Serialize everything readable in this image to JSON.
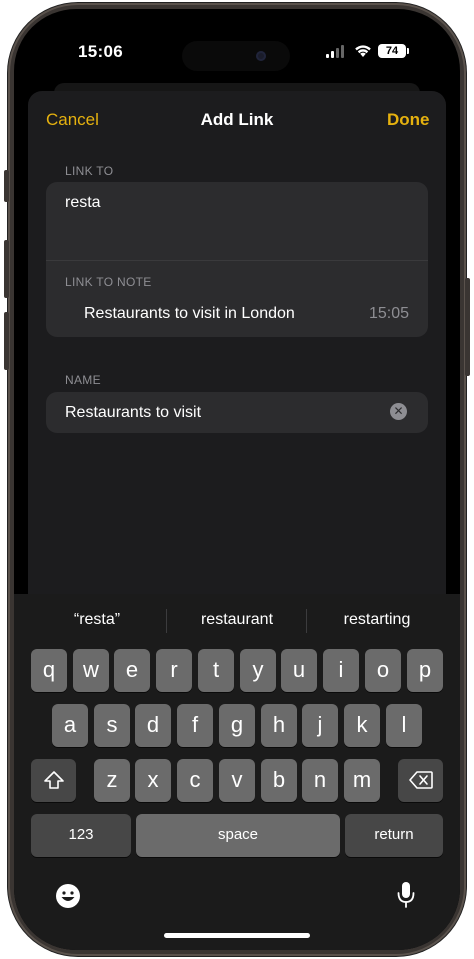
{
  "status_bar": {
    "time": "15:06",
    "battery": "74"
  },
  "nav": {
    "cancel": "Cancel",
    "title": "Add Link",
    "done": "Done"
  },
  "link_to": {
    "label": "LINK TO",
    "value": "resta"
  },
  "link_to_note": {
    "label": "LINK TO NOTE",
    "note_title": "Restaurants to visit in London",
    "note_time": "15:05"
  },
  "name_field": {
    "label": "NAME",
    "value": "Restaurants to visit"
  },
  "suggestions": [
    "“resta”",
    "restaurant",
    "restarting"
  ],
  "keyboard": {
    "row1": [
      "q",
      "w",
      "e",
      "r",
      "t",
      "y",
      "u",
      "i",
      "o",
      "p"
    ],
    "row2": [
      "a",
      "s",
      "d",
      "f",
      "g",
      "h",
      "j",
      "k",
      "l"
    ],
    "row3": [
      "z",
      "x",
      "c",
      "v",
      "b",
      "n",
      "m"
    ],
    "numbers": "123",
    "space": "space",
    "return": "return"
  },
  "colors": {
    "accent": "#e5b10f",
    "sheet_bg": "#1c1c1e",
    "group_bg": "#2c2c2e",
    "secondary_text": "#8e8e93"
  }
}
